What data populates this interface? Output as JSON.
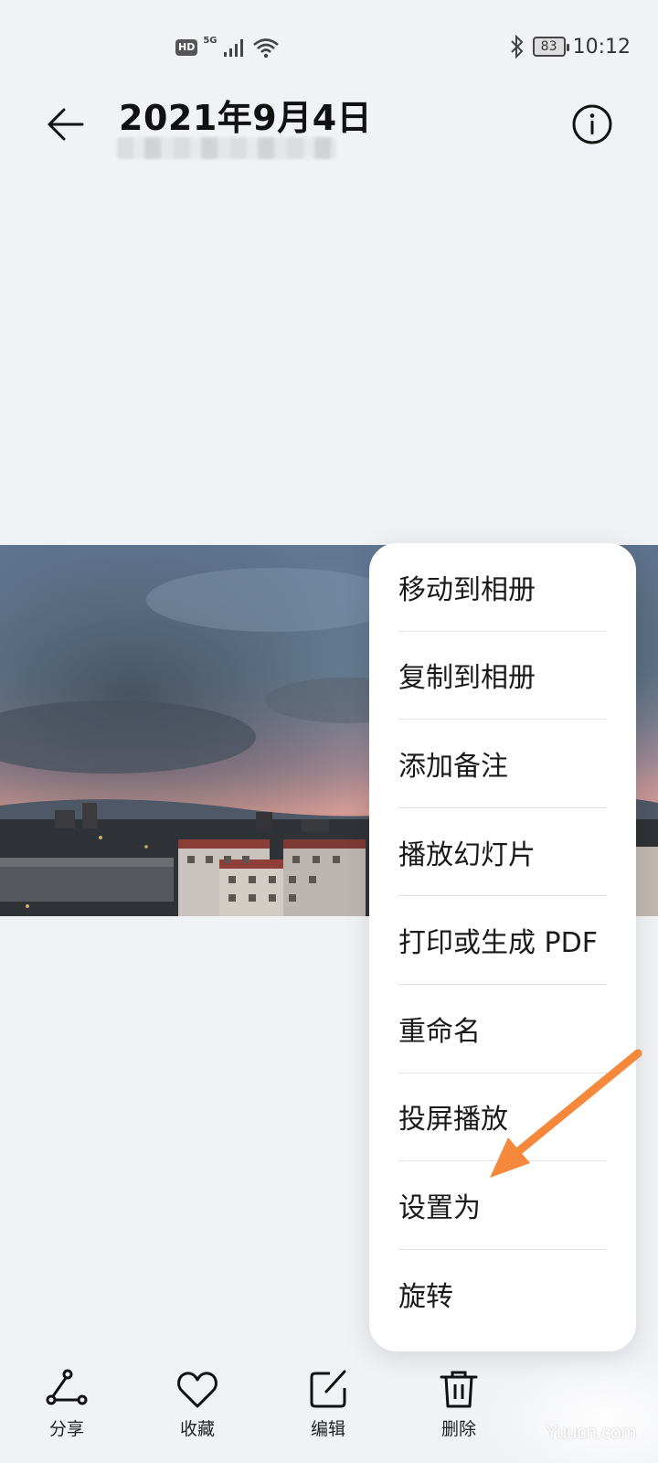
{
  "status_bar": {
    "hd": "HD",
    "network": "5G",
    "battery": "83",
    "time": "10:12"
  },
  "header": {
    "title": "2021年9月4日"
  },
  "menu": {
    "items": [
      {
        "label": "移动到相册"
      },
      {
        "label": "复制到相册"
      },
      {
        "label": "添加备注"
      },
      {
        "label": "播放幻灯片"
      },
      {
        "label": "打印或生成 PDF"
      },
      {
        "label": "重命名"
      },
      {
        "label": "投屏播放"
      },
      {
        "label": "设置为"
      },
      {
        "label": "旋转"
      }
    ]
  },
  "toolbar": {
    "share": "分享",
    "favorite": "收藏",
    "edit": "编辑",
    "delete": "删除"
  },
  "watermark": "Yuucn.com",
  "colors": {
    "background": "#f1f2f5",
    "menu_bg": "#ffffff",
    "annotation_arrow": "#f5883a"
  }
}
